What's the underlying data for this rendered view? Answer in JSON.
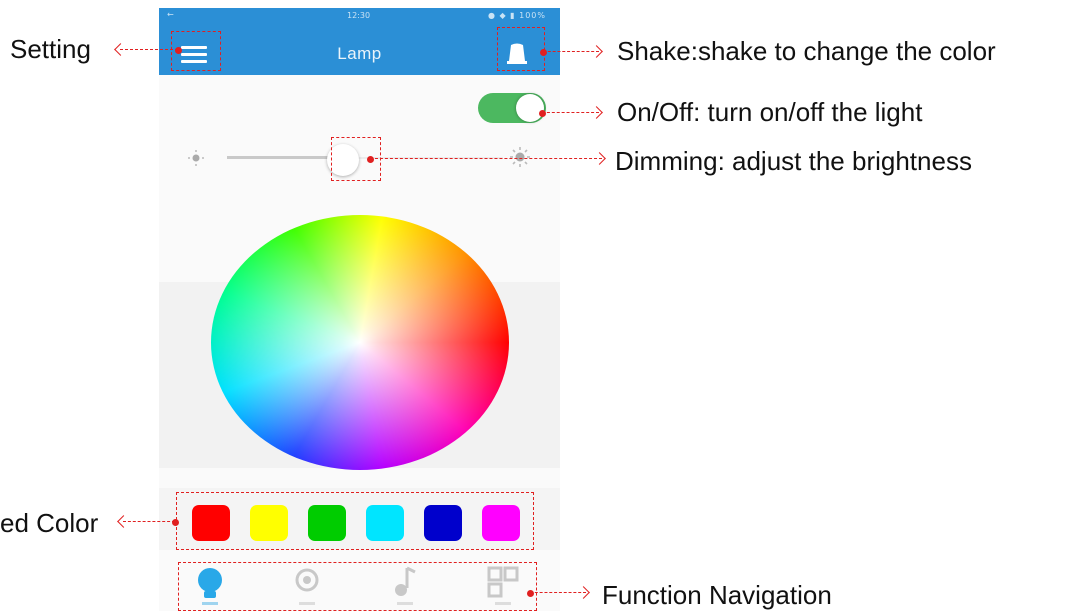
{
  "app": {
    "title": "Lamp",
    "status_time": "12:30",
    "status_icons": "● ◆ ▮ 100%",
    "status_back": "←",
    "accent_color": "#2b8fd6"
  },
  "controls": {
    "power_on": true,
    "brightness_fraction": 0.42
  },
  "preset_colors": [
    "#ff0000",
    "#ffff00",
    "#00cc00",
    "#00e5ff",
    "#0000cc",
    "#ff00ff"
  ],
  "icons": [
    "menu-icon",
    "shake-icon",
    "power-toggle",
    "brightness-low-icon",
    "brightness-high-icon",
    "bulb-icon",
    "mode-icon",
    "music-icon",
    "timer-icon"
  ],
  "annotations": {
    "setting": "Setting",
    "shake": "Shake:shake to change the color",
    "onoff": "On/Off: turn on/off the light",
    "dimming": "Dimming: adjust the brightness",
    "preset": "ed Color",
    "navigation": "Function Navigation"
  },
  "annotation_color": "#e02020"
}
